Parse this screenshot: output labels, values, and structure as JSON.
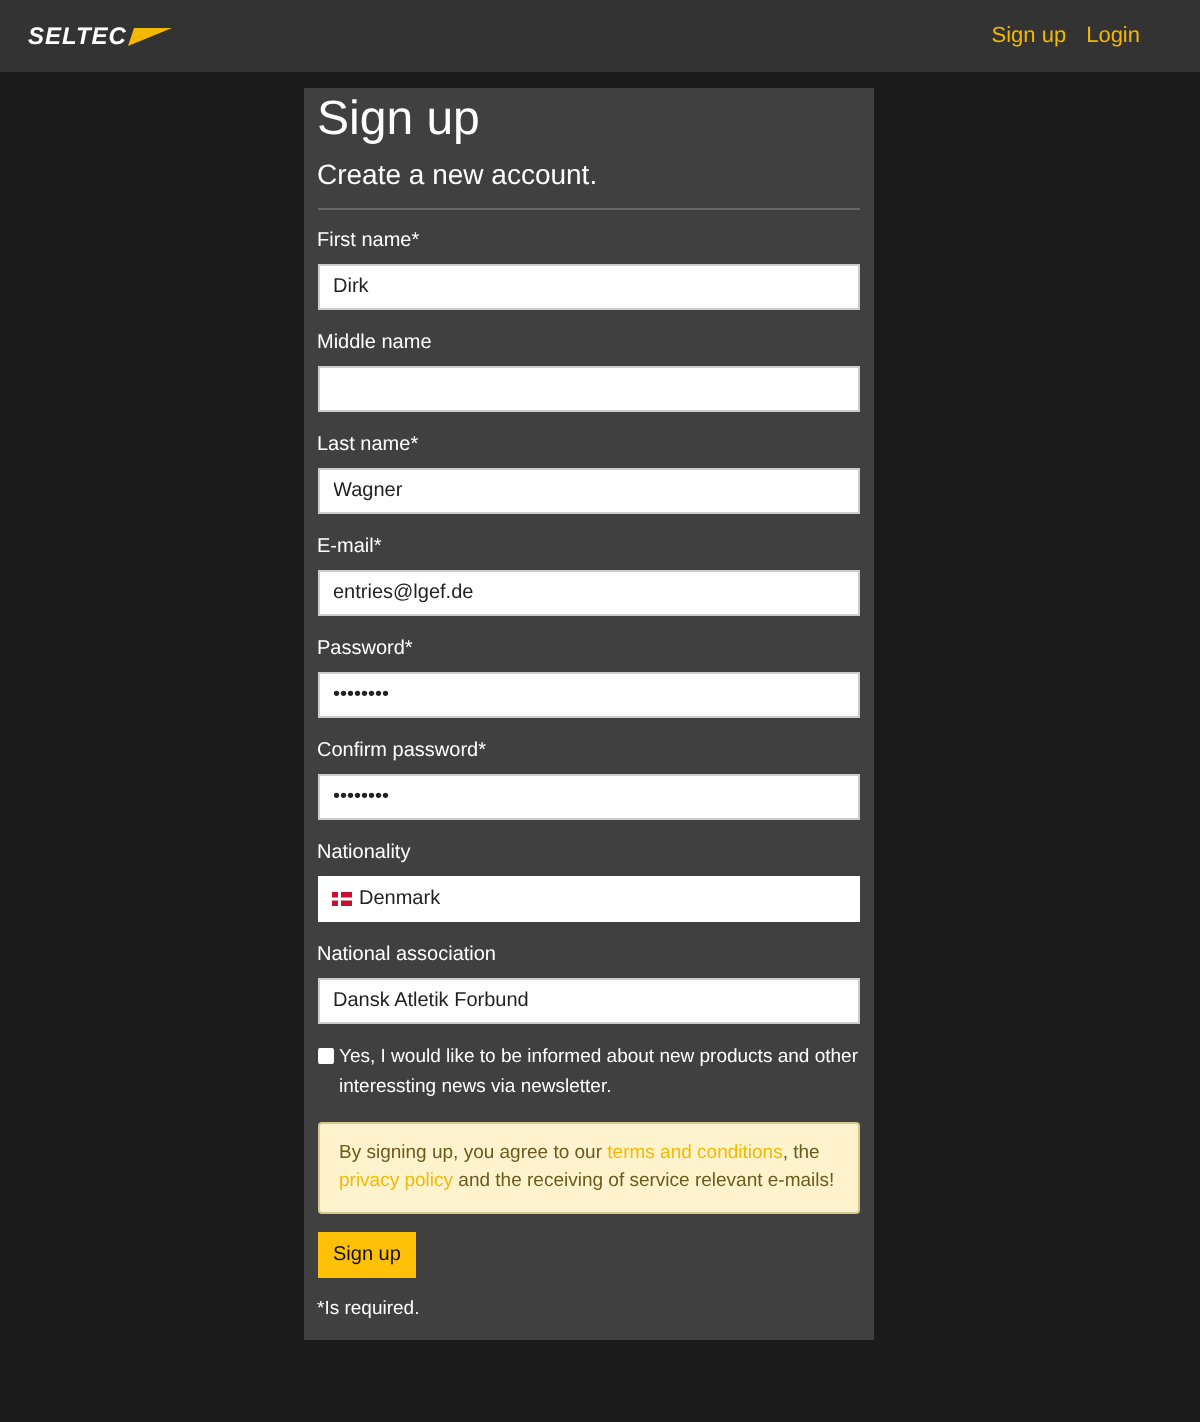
{
  "header": {
    "logo": "SELTEC",
    "nav": [
      {
        "label": "Sign up"
      },
      {
        "label": "Login"
      }
    ]
  },
  "form": {
    "title": "Sign up",
    "subtitle": "Create a new account.",
    "fields": [
      {
        "label": "First name*",
        "value": "Dirk",
        "kind": "text"
      },
      {
        "label": "Middle name",
        "kind": "text"
      },
      {
        "label": "Last name*",
        "value": "Wagner",
        "kind": "text"
      },
      {
        "label": "E-mail*",
        "value": "entries@lgef.de",
        "kind": "text"
      },
      {
        "label": "Password*",
        "value": "••••••••",
        "kind": "text"
      },
      {
        "label": "Confirm password*",
        "value": "••••••••",
        "kind": "text"
      },
      {
        "label": "Nationality",
        "value": "Denmark",
        "kind": "flag"
      },
      {
        "label": "National association",
        "value": "Dansk Atletik Forbund",
        "kind": "text"
      }
    ],
    "newsletter": {
      "label": "Yes, I would like to be informed about new products and other interessting news via newsletter.",
      "checked": false
    },
    "notice": [
      {
        "kind": "text",
        "text": "By signing up, you agree to our "
      },
      {
        "kind": "link",
        "text": "terms and conditions"
      },
      {
        "kind": "text",
        "text": ", the "
      },
      {
        "kind": "link",
        "text": "privacy policy"
      },
      {
        "kind": "text",
        "text": " and the receiving of service relevant e-mails!"
      }
    ],
    "submit": "Sign up",
    "footnote": "*Is required."
  }
}
